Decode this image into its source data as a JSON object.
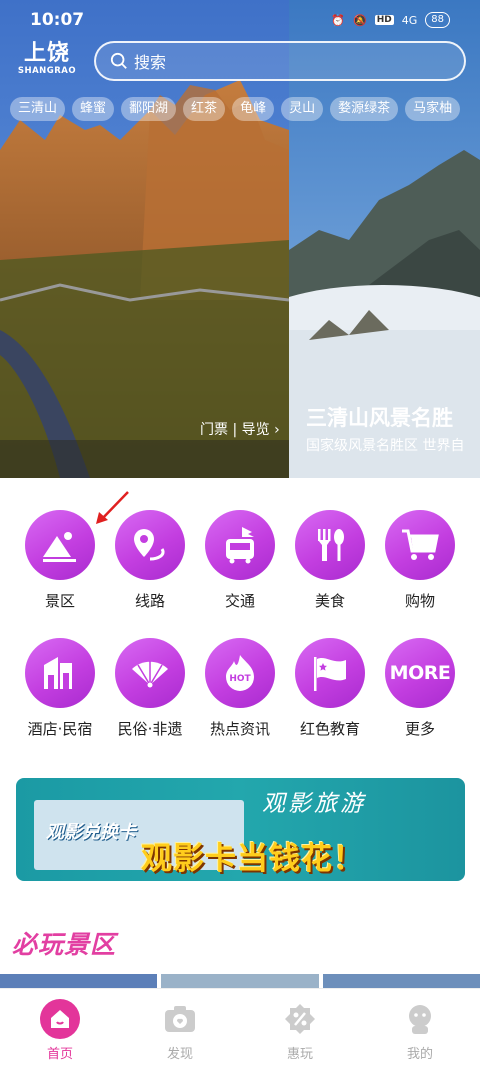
{
  "status_bar": {
    "time": "10:07",
    "battery": "88",
    "network": "4G",
    "hd": "HD"
  },
  "header": {
    "logo_cn": "上饶",
    "logo_en": "SHANGRAO",
    "search_placeholder": "搜索"
  },
  "tags": [
    "三清山",
    "蜂蜜",
    "鄱阳湖",
    "红茶",
    "龟峰",
    "灵山",
    "婺源绿茶",
    "马家柚"
  ],
  "carousel": {
    "link_text": "门票 | 导览",
    "slide_title": "三清山风景名胜",
    "slide_subtitle": "国家级风景名胜区 世界自"
  },
  "categories": [
    {
      "label": "景区",
      "icon": "scenic-icon"
    },
    {
      "label": "线路",
      "icon": "route-icon"
    },
    {
      "label": "交通",
      "icon": "transport-icon"
    },
    {
      "label": "美食",
      "icon": "food-icon"
    },
    {
      "label": "购物",
      "icon": "shopping-cart-icon"
    },
    {
      "label": "酒店·民宿",
      "icon": "hotel-icon"
    },
    {
      "label": "民俗·非遗",
      "icon": "folk-fan-icon"
    },
    {
      "label": "热点资讯",
      "icon": "hot-news-icon"
    },
    {
      "label": "红色教育",
      "icon": "red-flag-icon"
    },
    {
      "label": "更多",
      "icon": "more-icon",
      "icon_text": "MORE"
    }
  ],
  "banner": {
    "card_text": "观影兑换卡",
    "headline": "观影卡当钱花！",
    "top_text": "观影旅游"
  },
  "section_title": "必玩景区",
  "tabbar": [
    {
      "label": "首页",
      "icon": "home-icon",
      "active": true
    },
    {
      "label": "发现",
      "icon": "camera-icon",
      "active": false
    },
    {
      "label": "惠玩",
      "icon": "discount-icon",
      "active": false
    },
    {
      "label": "我的",
      "icon": "user-icon",
      "active": false
    }
  ],
  "colors": {
    "accent": "#e3359a",
    "category_purple": "#c33ee0",
    "banner_teal": "#1b9aa4"
  }
}
